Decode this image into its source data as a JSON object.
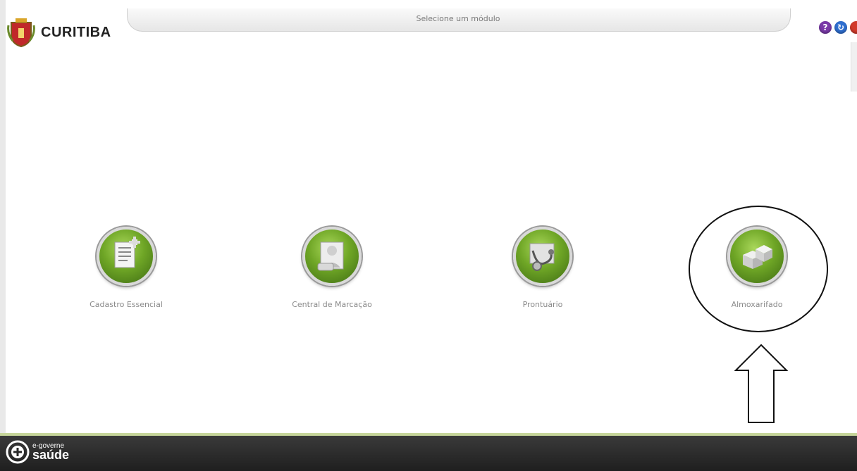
{
  "header": {
    "title": "Selecione um módulo",
    "logo_text": "CURITIBA",
    "window_buttons": [
      {
        "icon": "help-icon",
        "glyph": "?",
        "color": "#7a3aa8"
      },
      {
        "icon": "refresh-icon",
        "glyph": "↻",
        "color": "#2f6fd0"
      },
      {
        "icon": "close-icon",
        "glyph": "●",
        "color": "#d23a2a"
      }
    ]
  },
  "modules": [
    {
      "label": "Cadastro Essencial",
      "icon": "document-icon"
    },
    {
      "label": "Central de Marcação",
      "icon": "calendar-icon"
    },
    {
      "label": "Prontuário",
      "icon": "stethoscope-icon"
    },
    {
      "label": "Almoxarifado",
      "icon": "boxes-icon"
    }
  ],
  "footer": {
    "brand_small": "e-governe",
    "brand_big": "saúde"
  },
  "colors": {
    "module_green": "#6fa626",
    "footer_bg": "#2a2a2a",
    "footer_accent": "#c7d69b"
  }
}
